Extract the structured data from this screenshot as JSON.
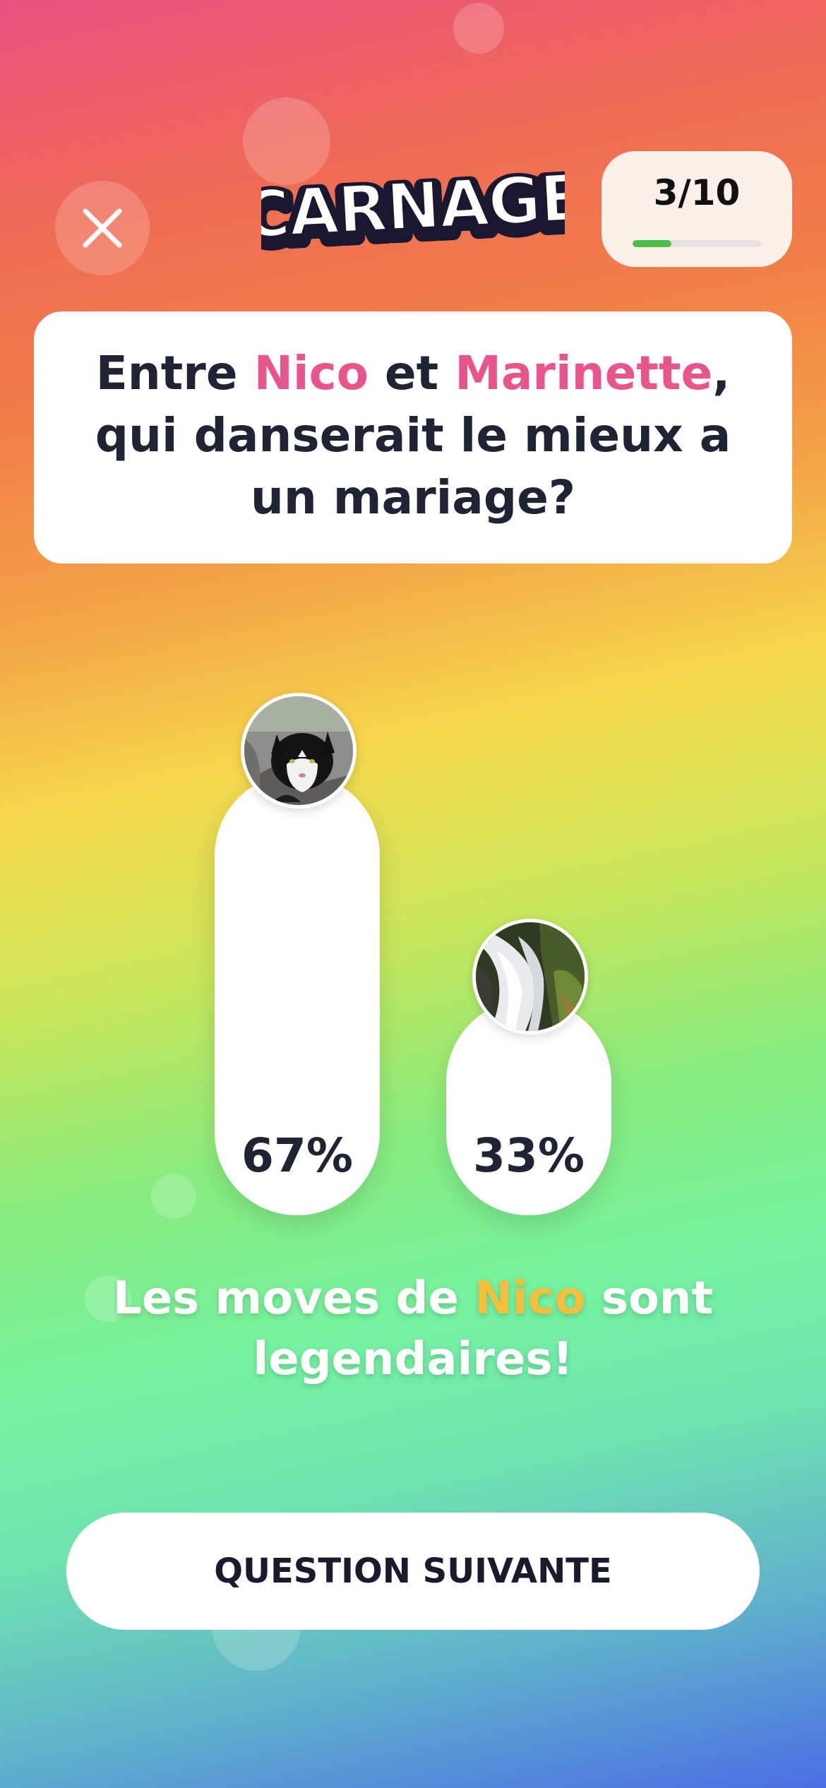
{
  "header": {
    "close_icon": "close-icon",
    "logo_text": "CARNAGE",
    "progress": {
      "label": "3/10",
      "current": 3,
      "total": 10
    }
  },
  "question": {
    "part1": "Entre ",
    "name1": "Nico",
    "part2": " et ",
    "name2": "Marinette",
    "part3": ", qui danserait le mieux a un mariage?"
  },
  "results": [
    {
      "percent_label": "67%",
      "percent": 67,
      "avatar": "cat-photo"
    },
    {
      "percent_label": "33%",
      "percent": 33,
      "avatar": "waterfall-photo"
    }
  ],
  "verdict": {
    "part1": "Les moves de ",
    "highlight": "Nico",
    "part2": " sont legendaires!"
  },
  "next_button": {
    "label": "QUESTION SUIVANTE"
  },
  "colors": {
    "name_highlight": "#e8558c",
    "verdict_highlight": "#f4bf3c",
    "progress_fill": "#4cc04a",
    "text_dark": "#1e2433"
  }
}
